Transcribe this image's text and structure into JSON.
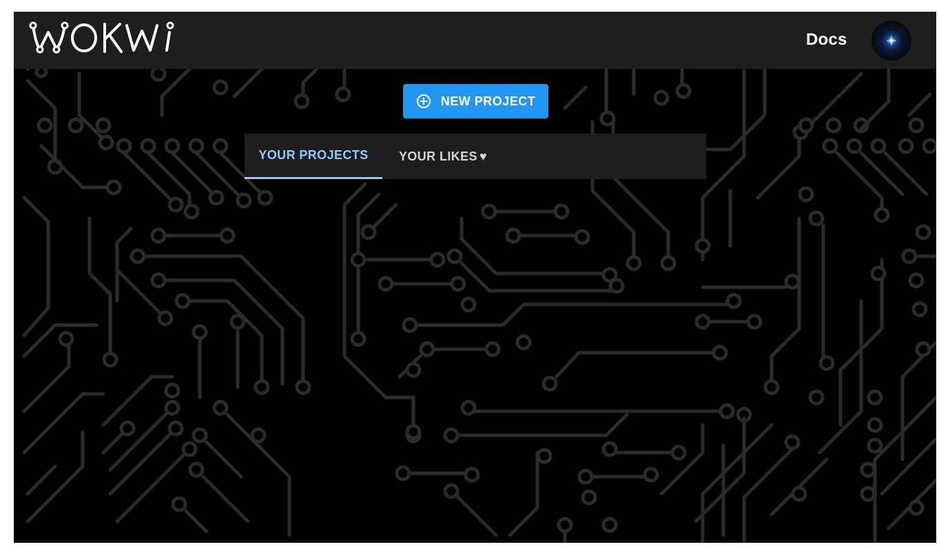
{
  "header": {
    "logo_text": "WOKWi",
    "docs_label": "Docs",
    "avatar": "user-avatar"
  },
  "main": {
    "new_project_label": "NEW PROJECT",
    "new_project_icon": "plus-circle-icon",
    "tabs": [
      {
        "label": "YOUR PROJECTS",
        "active": true
      },
      {
        "label": "YOUR LIKES",
        "active": false,
        "icon": "heart-icon"
      }
    ]
  },
  "colors": {
    "accent": "#2196f3",
    "tab_active": "#90caf9",
    "topbar": "#1e1e1e",
    "background": "#000000",
    "circuit_trace": "#2b2b2b"
  }
}
